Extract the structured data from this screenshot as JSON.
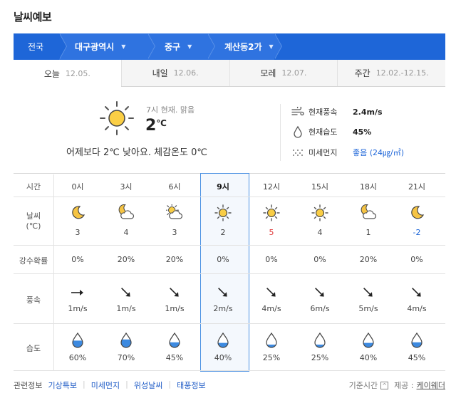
{
  "title": "날씨예보",
  "location": [
    "전국",
    "대구광역시",
    "중구",
    "계산동2가"
  ],
  "tabs": [
    {
      "label": "오늘",
      "date": "12.05."
    },
    {
      "label": "내일",
      "date": "12.06."
    },
    {
      "label": "모레",
      "date": "12.07."
    },
    {
      "label": "주간",
      "date": "12.02.-12.15."
    }
  ],
  "current": {
    "meta": "7시 현재. 맑음",
    "temp": "2",
    "unit": "℃",
    "compare": "어제보다 2℃ 낮아요.   체감온도 0℃",
    "wind_label": "현재풍속",
    "wind": "2.4m/s",
    "humid_label": "현재습도",
    "humid": "45%",
    "dust_label": "미세먼지",
    "dust": "좋음 (24㎍/㎥)"
  },
  "table": {
    "time_label": "시간",
    "weather_label": "날씨",
    "weather_unit": "(℃)",
    "rain_label": "강수확률",
    "wind_label": "풍속",
    "humid_label": "습도",
    "hours": [
      "0시",
      "3시",
      "6시",
      "9시",
      "12시",
      "15시",
      "18시",
      "21시"
    ],
    "icons": [
      "moon",
      "moon-cloud",
      "sun-cloud",
      "sun",
      "sun",
      "sun",
      "moon-cloud",
      "moon"
    ],
    "temps": [
      "3",
      "4",
      "3",
      "2",
      "5",
      "4",
      "1",
      "-2"
    ],
    "rain": [
      "0%",
      "20%",
      "20%",
      "0%",
      "0%",
      "0%",
      "20%",
      "0%"
    ],
    "winds": [
      "1m/s",
      "1m/s",
      "1m/s",
      "2m/s",
      "4m/s",
      "6m/s",
      "5m/s",
      "4m/s"
    ],
    "wind_dirs": [
      "east",
      "southeast",
      "southeast",
      "southeast",
      "southeast",
      "southeast",
      "southeast",
      "southeast"
    ],
    "humids": [
      "60%",
      "70%",
      "45%",
      "40%",
      "25%",
      "25%",
      "40%",
      "45%"
    ],
    "humid_levels": [
      60,
      70,
      45,
      40,
      25,
      25,
      40,
      45
    ]
  },
  "footer": {
    "related": "관련정보",
    "links": [
      "기상특보",
      "미세먼지",
      "위성날씨",
      "태풍정보"
    ],
    "basis": "기준시간",
    "source_label": "제공 :",
    "source": "케이웨더"
  },
  "colors": {
    "accent": "#1e66d8",
    "high": "#e03a3a",
    "low": "#1e66d8"
  }
}
